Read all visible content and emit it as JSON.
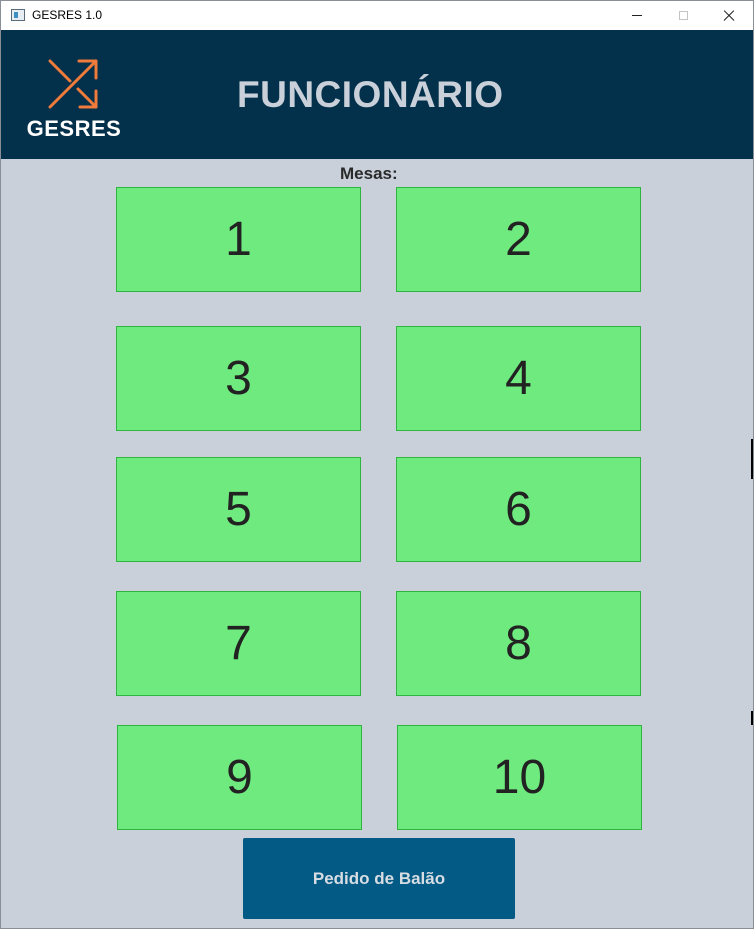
{
  "window": {
    "title": "GESRES 1.0"
  },
  "header": {
    "logo_text": "GESRES",
    "page_title": "FUNCIONÁRIO"
  },
  "content": {
    "mesas_label": "Mesas:",
    "tables": [
      "1",
      "2",
      "3",
      "4",
      "5",
      "6",
      "7",
      "8",
      "9",
      "10"
    ],
    "balao_button": "Pedido de Balão"
  },
  "colors": {
    "header_bg": "#03314b",
    "table_green": "#6fea7f",
    "button_blue": "#035a85",
    "logo_orange": "#f07b3a"
  },
  "icons": {
    "logo": "shuffle-arrows-icon",
    "minimize": "minimize-icon",
    "maximize": "maximize-icon",
    "close": "close-icon"
  }
}
